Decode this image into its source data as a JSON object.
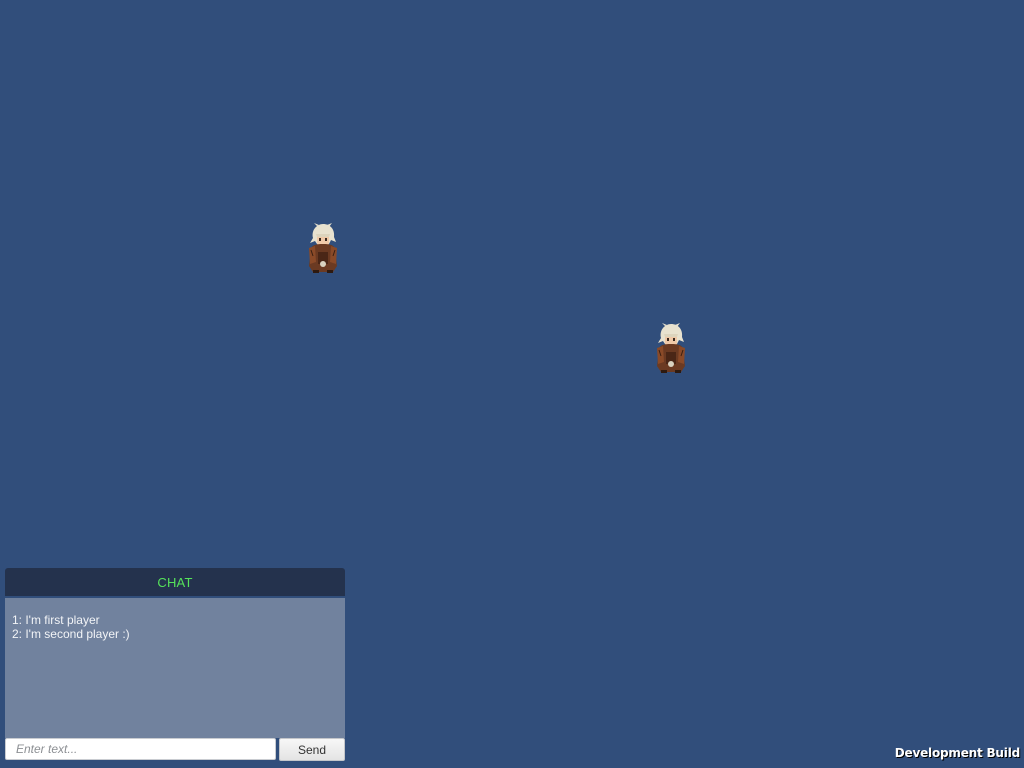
{
  "scene": {
    "background_color": "#314e7b",
    "players": [
      {
        "id": "player-1",
        "sprite": "white-haired-warrior-sprite"
      },
      {
        "id": "player-2",
        "sprite": "white-haired-warrior-sprite"
      }
    ]
  },
  "chat": {
    "title": "CHAT",
    "title_color": "#55e25a",
    "messages": [
      "1: I'm first player",
      "2: I'm second player :)"
    ],
    "input": {
      "value": "",
      "placeholder": "Enter text..."
    },
    "send_label": "Send"
  },
  "footer": {
    "dev_build_label": "Development Build"
  }
}
